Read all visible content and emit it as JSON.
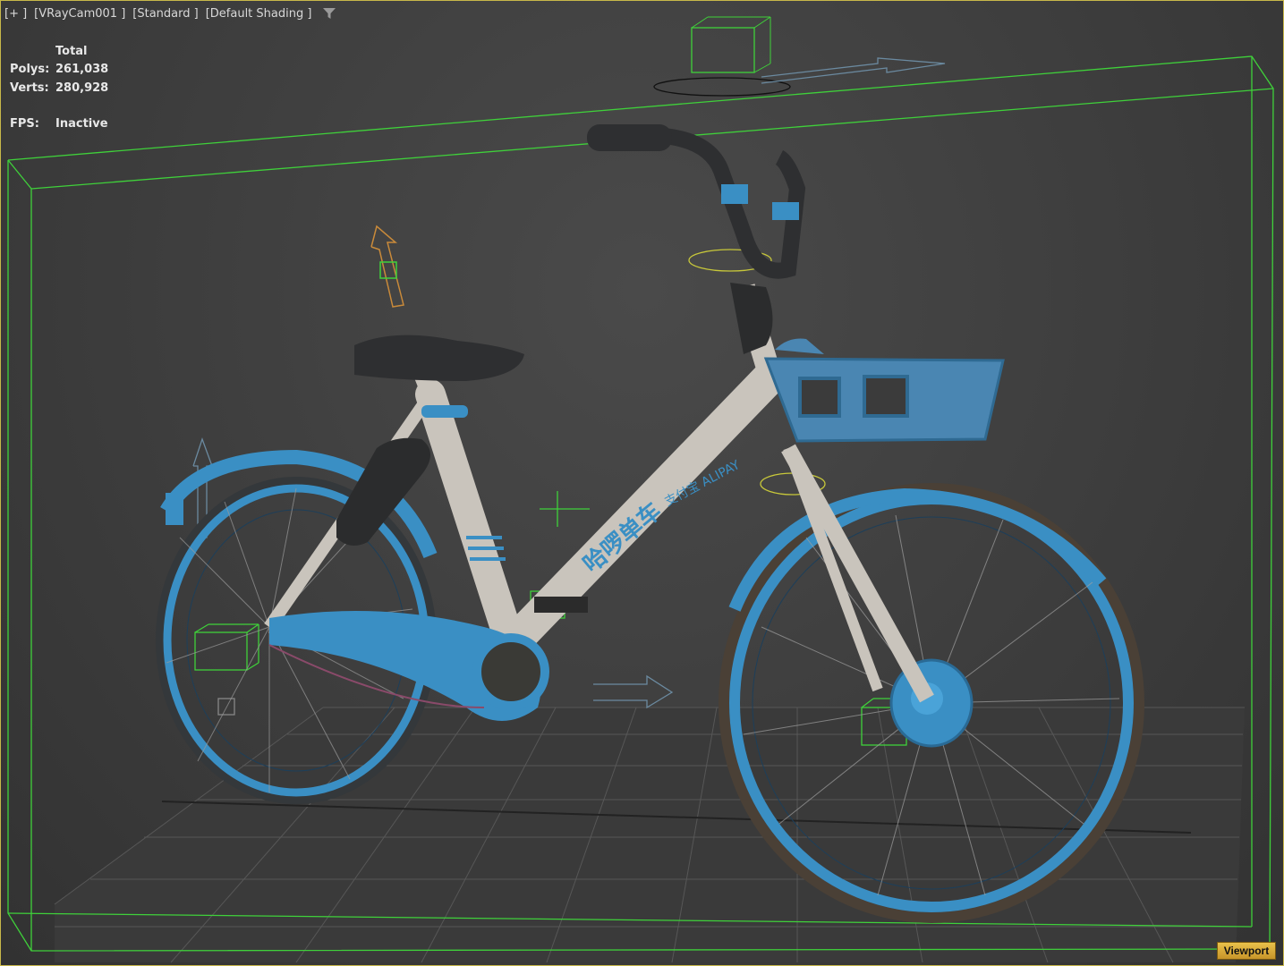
{
  "viewport": {
    "labels": [
      "[+ ]",
      "[VRayCam001 ]",
      "[Standard ]",
      "[Default Shading ]"
    ],
    "filter_icon": "funnel-icon",
    "stats": {
      "header": "Total",
      "polys_label": "Polys:",
      "polys_value": "261,038",
      "verts_label": "Verts:",
      "verts_value": "280,928",
      "fps_label": "FPS:",
      "fps_value": "Inactive"
    },
    "badge_label": "Viewport",
    "colors": {
      "background": "#3f3f3f",
      "grid": "#5a5a5a",
      "selection_box": "#3fd13a",
      "bike_blue": "#3a8fc4",
      "bike_frame": "#c9c4bc",
      "helper_orange": "#c98a3a",
      "badge": "#d9a63c"
    }
  },
  "scene": {
    "frame_text": "哈啰单车",
    "basket_logo": "支付宝 ALIPAY"
  }
}
